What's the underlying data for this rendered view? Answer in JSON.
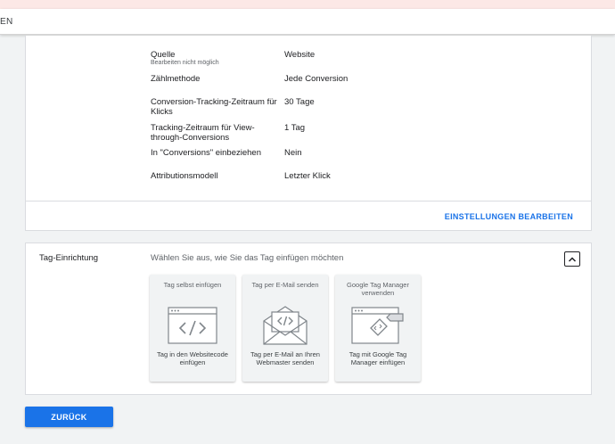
{
  "header": {
    "text": "EN"
  },
  "details": [
    {
      "label": "Quelle",
      "sublabel": "Bearbeiten nicht möglich",
      "value": "Website"
    },
    {
      "label": "Zählmethode",
      "value": "Jede Conversion"
    },
    {
      "label": "Conversion-Tracking-Zeitraum für Klicks",
      "value": "30 Tage"
    },
    {
      "label": "Tracking-Zeitraum für View-through-Conversions",
      "value": "1 Tag"
    },
    {
      "label": "In \"Conversions\" einbeziehen",
      "value": "Nein"
    },
    {
      "label": "Attributionsmodell",
      "value": "Letzter Klick"
    }
  ],
  "edit_settings_label": "EINSTELLUNGEN BEARBEITEN",
  "tag_setup": {
    "title": "Tag-Einrichtung",
    "hint": "Wählen Sie aus, wie Sie das Tag einfügen möchten",
    "options": [
      {
        "title": "Tag selbst einfügen",
        "description": "Tag in den Websitecode einfügen",
        "icon": "browser-code-icon"
      },
      {
        "title": "Tag per E-Mail senden",
        "description": "Tag per E-Mail an Ihren Webmaster senden",
        "icon": "email-code-icon"
      },
      {
        "title": "Google Tag Manager verwenden",
        "description": "Tag mit Google Tag Manager einfügen",
        "icon": "tag-manager-icon"
      }
    ]
  },
  "back_button": "ZURÜCK",
  "colors": {
    "accent": "#1a73e8",
    "background": "#f1f3f4",
    "top_band": "#fce8e6"
  }
}
